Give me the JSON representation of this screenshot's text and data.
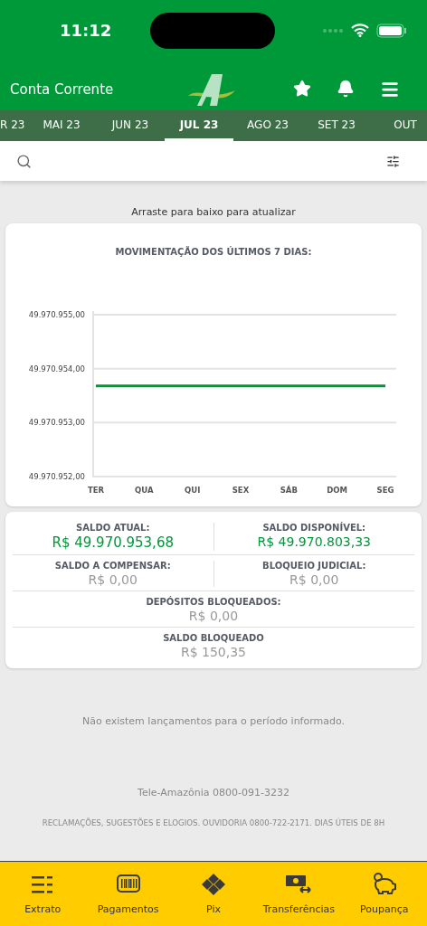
{
  "status_bar": {
    "time": "11:12"
  },
  "header": {
    "title": "Conta Corrente"
  },
  "months": [
    {
      "label": "R 23",
      "selected": false
    },
    {
      "label": "MAI 23",
      "selected": false
    },
    {
      "label": "JUN 23",
      "selected": false
    },
    {
      "label": "JUL 23",
      "selected": true
    },
    {
      "label": "AGO 23",
      "selected": false
    },
    {
      "label": "SET 23",
      "selected": false
    },
    {
      "label": "OUT",
      "selected": false
    }
  ],
  "pull_hint": "Arraste para baixo para atualizar",
  "chart_card": {
    "title": "MOVIMENTAÇÃO DOS ÚLTIMOS 7 DIAS:",
    "chart_data": {
      "type": "line",
      "categories": [
        "TER",
        "QUA",
        "QUI",
        "SEX",
        "SÁB",
        "DOM",
        "SEG"
      ],
      "series": [
        {
          "color": "#00963a",
          "values": [
            49970953.68,
            49970953.68,
            49970953.68,
            49970953.68,
            49970953.68,
            49970953.68,
            49970953.68
          ]
        }
      ],
      "ylim": [
        49970952,
        49970955
      ],
      "yticks": [
        {
          "value": 49970955,
          "label": "49.970.955,00"
        },
        {
          "value": 49970954,
          "label": "49.970.954,00"
        },
        {
          "value": 49970953,
          "label": "49.970.953,00"
        },
        {
          "value": 49970952,
          "label": "49.970.952,00"
        }
      ]
    }
  },
  "balances": [
    [
      {
        "label": "SALDO ATUAL:",
        "value": "R$ 49.970.953,68",
        "kind": "highlight"
      },
      {
        "label": "SALDO DISPONÍVEL:",
        "value": "R$ 49.970.803,33",
        "kind": "positive"
      }
    ],
    [
      {
        "label": "SALDO A COMPENSAR:",
        "value": "R$ 0,00",
        "kind": "neutral"
      },
      {
        "label": "BLOQUEIO JUDICIAL:",
        "value": "R$ 0,00",
        "kind": "neutral"
      }
    ],
    [
      {
        "label": "DEPÓSITOS BLOQUEADOS:",
        "value": "R$ 0,00",
        "kind": "neutral"
      }
    ],
    [
      {
        "label": "SALDO BLOQUEADO",
        "value": "R$ 150,35",
        "kind": "neutral"
      }
    ]
  ],
  "empty_message": "Não existem lançamentos para o período informado.",
  "contact": "Tele-Amazônia 0800-091-3232",
  "ombudsman": "RECLAMAÇÕES, SUGESTÕES E ELOGIOS. OUVIDORIA 0800-722-2171. DIAS ÚTEIS DE 8H",
  "bottom_nav": [
    {
      "label": "Extrato",
      "kind": "list"
    },
    {
      "label": "Pagamentos",
      "kind": "barcode"
    },
    {
      "label": "Pix",
      "kind": "pix"
    },
    {
      "label": "Transferências",
      "kind": "transfer"
    },
    {
      "label": "Poupança",
      "kind": "piggy"
    }
  ]
}
